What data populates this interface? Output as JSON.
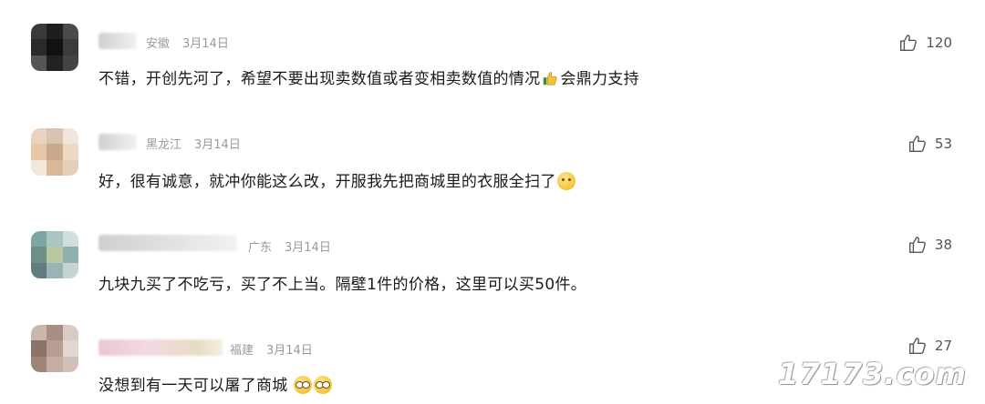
{
  "comments": [
    {
      "location": "安徽",
      "date": "3月14日",
      "text_before": "不错，开创先河了，希望不要出现卖数值或者变相卖数值的情况",
      "inline_emoji": "thumbs-up-emoji",
      "text_after": "会鼎力支持",
      "likes": "120"
    },
    {
      "location": "黑龙江",
      "date": "3月14日",
      "text_before": "好，很有诚意，就冲你能这么改，开服我先把商城里的衣服全扫了",
      "inline_emoji": "confused-face-emoji",
      "text_after": "",
      "likes": "53"
    },
    {
      "location": "广东",
      "date": "3月14日",
      "text_before": "九块九买了不吃亏，买了不上当。隔壁1件的价格，这里可以买50件。",
      "inline_emoji": "",
      "text_after": "",
      "likes": "38"
    },
    {
      "location": "福建",
      "date": "3月14日",
      "text_before": "没想到有一天可以屠了商城",
      "inline_emoji": "rolling-eyes-emoji",
      "text_after": "",
      "likes": "27"
    }
  ],
  "watermark": "17173.com",
  "colors": {
    "text": "#1a1a1a",
    "meta": "#9a9a9a",
    "like": "#555555"
  }
}
